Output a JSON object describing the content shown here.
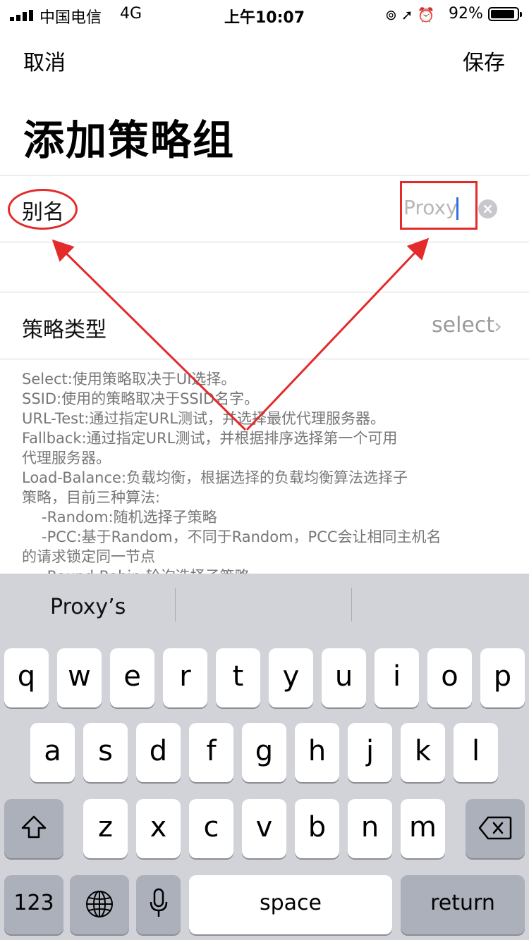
{
  "status_bar": {
    "carrier": "中国电信",
    "network": "4G",
    "time": "上午10:07",
    "battery_percent": "92%",
    "battery_level": 0.92,
    "icons": [
      "signal-icon",
      "orientation-lock-icon",
      "location-icon",
      "alarm-icon",
      "battery-icon"
    ]
  },
  "nav": {
    "cancel_label": "取消",
    "save_label": "保存"
  },
  "page": {
    "title": "添加策略组"
  },
  "form": {
    "alias_label": "别名",
    "alias_placeholder": "Proxy",
    "policy_type_label": "策略类型",
    "policy_type_value": "select"
  },
  "description": {
    "lines": [
      "Select:使用策略取决于UI选择。",
      "SSID:使用的策略取决于SSID名字。",
      "URL-Test:通过指定URL测试，并选择最优代理服务器。",
      "Fallback:通过指定URL测试，并根据排序选择第一个可用",
      "代理服务器。",
      "Load-Balance:负载均衡，根据选择的负载均衡算法选择子",
      "策略，目前三种算法:",
      "-Random:随机选择子策略",
      "-PCC:基于Random，不同于Random，PCC会让相同主机名",
      "的请求锁定同一节点",
      "-Round-Robin:轮询选择子策略"
    ]
  },
  "annotations": {
    "color": "#e32b2b"
  },
  "keyboard": {
    "suggestions": [
      "Proxy’s",
      "",
      ""
    ],
    "row1": [
      "q",
      "w",
      "e",
      "r",
      "t",
      "y",
      "u",
      "i",
      "o",
      "p"
    ],
    "row2": [
      "a",
      "s",
      "d",
      "f",
      "g",
      "h",
      "j",
      "k",
      "l"
    ],
    "row3": [
      "z",
      "x",
      "c",
      "v",
      "b",
      "n",
      "m"
    ],
    "numbers_label": "123",
    "space_label": "space",
    "return_label": "return"
  }
}
